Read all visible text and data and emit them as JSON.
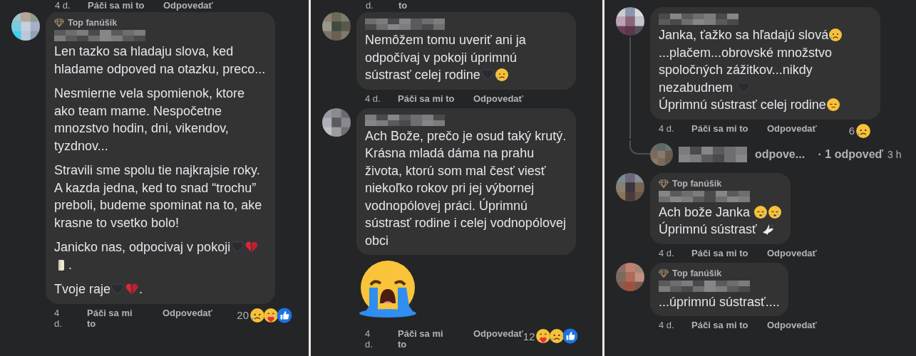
{
  "panels": [
    {
      "cut_meta": {
        "time": "4 d.",
        "like": "Páči sa mi to",
        "reply": "Odpovedať"
      },
      "comments": [
        {
          "badge": "Top fanúšik",
          "paragraphs": [
            [
              {
                "kind": "text",
                "text": "Len tazko sa hladaju slova, ked hladame odpoved na otazku, preco..."
              }
            ],
            [
              {
                "kind": "text",
                "text": "Nesmierne vela spomienok, ktore ako team mame. Nespočetne mnozstvo hodin, dni, vikendov, tyzdnov..."
              }
            ],
            [
              {
                "kind": "text",
                "text": "Stravili sme spolu tie najkrajsie roky. A kazda jedna, ked to snad “trochu” preboli, budeme spominat na to, ake krasne to vsetko bolo!"
              }
            ],
            [
              {
                "kind": "text",
                "text": "Janicko nas, odpocivaj v pokoji"
              },
              {
                "kind": "black-heart"
              },
              {
                "kind": "broken-heart"
              },
              {
                "kind": "candle"
              },
              {
                "kind": "text",
                "text": "."
              }
            ],
            [
              {
                "kind": "text",
                "text": "Tvoje raje"
              },
              {
                "kind": "black-heart"
              },
              {
                "kind": "broken-heart"
              },
              {
                "kind": "text",
                "text": "."
              }
            ]
          ],
          "footer": {
            "time": "4 d.",
            "like": "Páči sa mi to",
            "reply": "Odpovedať",
            "count": "20",
            "reactions": [
              {
                "kind": "sad-tear"
              },
              {
                "kind": "hug"
              },
              {
                "kind": "like"
              }
            ]
          }
        }
      ]
    },
    {
      "cut_meta": {
        "time": "d.",
        "like": "to"
      },
      "comments": [
        {
          "paragraphs": [
            [
              {
                "kind": "text",
                "text": "Nemôžem tomu uveriť ani ja odpočívaj v pokoji úprimnú"
              },
              {
                "kind": "break"
              },
              {
                "kind": "text",
                "text": "sústrasť celej rodine"
              },
              {
                "kind": "black-heart"
              },
              {
                "kind": "sad-tear"
              }
            ]
          ],
          "footer": {
            "time": "4 d.",
            "like": "Páči sa mi to",
            "reply": "Odpovedať"
          }
        },
        {
          "paragraphs": [
            [
              {
                "kind": "text",
                "text": "Ach Bože, prečo je osud taký krutý. Krásna mladá dáma na prahu života, ktorú som mal česť viesť niekoľko rokov pri jej výbornej vodnopólovej práci. Úprimnú sústrasť rodine i celej vodnopólovej obci"
              }
            ]
          ],
          "attachment": {
            "kind": "crying-face"
          },
          "footer": {
            "time": "4 d.",
            "like": "Páči sa mi to",
            "reply": "Odpovedať",
            "count": "12",
            "reactions": [
              {
                "kind": "hug"
              },
              {
                "kind": "sad-tear"
              },
              {
                "kind": "like"
              }
            ]
          }
        }
      ]
    },
    {
      "comments": [
        {
          "paragraphs": [
            [
              {
                "kind": "text",
                "text": "Janka, ťažko sa hľadajú slová"
              },
              {
                "kind": "sad-tear"
              },
              {
                "kind": "break"
              },
              {
                "kind": "text",
                "text": "...plačem...obrovské množstvo spoločných zážitkov...nikdy"
              },
              {
                "kind": "break"
              },
              {
                "kind": "text",
                "text": "nezabudnem "
              },
              {
                "kind": "black-heart"
              },
              {
                "kind": "break"
              },
              {
                "kind": "text",
                "text": "Úprimnú sústrasť celej rodine"
              },
              {
                "kind": "tired"
              }
            ]
          ],
          "footer": {
            "time": "4 d.",
            "like": "Páči sa mi to",
            "reply": "Odpovedať",
            "count": "6",
            "reactions": [
              {
                "kind": "sad-tear"
              }
            ]
          },
          "thread": {
            "label": "odpove...",
            "replies": "· 1 odpoveď",
            "time": "3 h"
          }
        },
        {
          "badge": "Top fanúšik",
          "paragraphs": [
            [
              {
                "kind": "text",
                "text": "Ach bože Janka "
              },
              {
                "kind": "sleepy"
              },
              {
                "kind": "sleepy"
              },
              {
                "kind": "break"
              },
              {
                "kind": "text",
                "text": "Úprimnú sústrasť "
              },
              {
                "kind": "dove"
              }
            ]
          ],
          "footer": {
            "time": "4 d.",
            "like": "Páči sa mi to",
            "reply": "Odpovedať"
          }
        },
        {
          "badge": "Top fanúšik",
          "paragraphs": [
            [
              {
                "kind": "text",
                "text": "...úprimnú sústrasť...."
              }
            ]
          ],
          "footer": {
            "time": "4 d.",
            "like": "Páči sa mi to",
            "reply": "Odpovedať"
          }
        }
      ]
    }
  ]
}
